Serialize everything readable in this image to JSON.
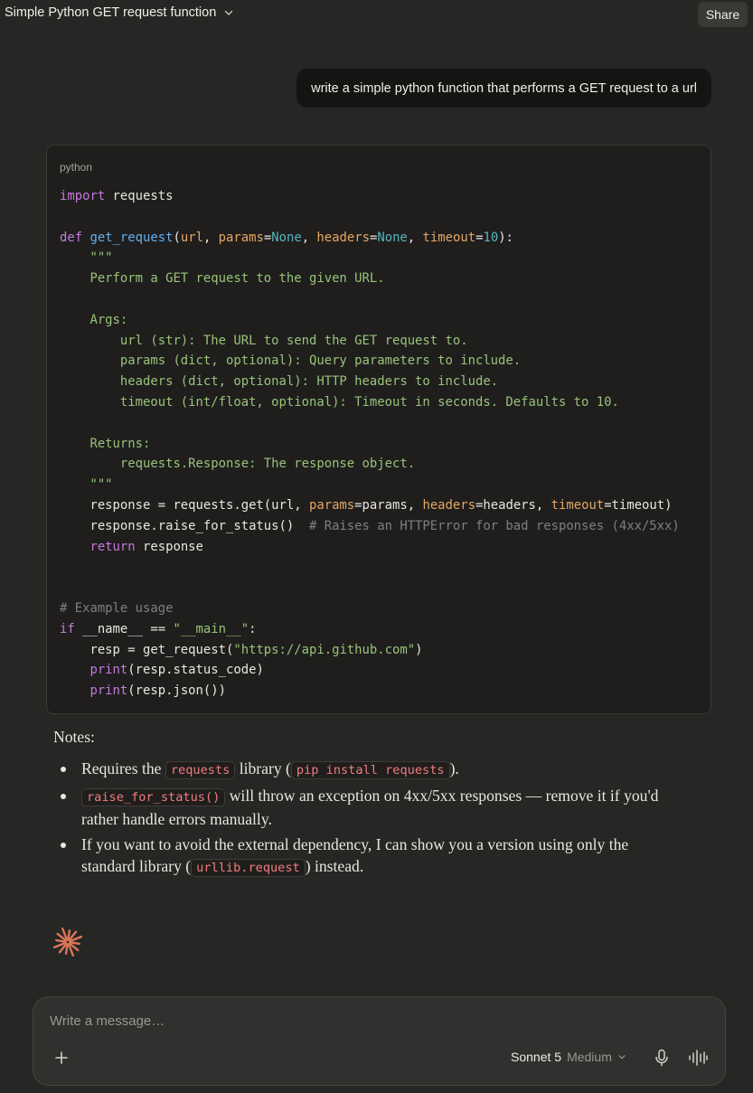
{
  "header": {
    "chat_title": "Simple Python GET request function",
    "share_label": "Share",
    "dropdown_icon": "chevron-down-icon"
  },
  "user_message": "write a simple python function that performs a GET request to a url",
  "code_block": {
    "language": "python",
    "lines": [
      "import requests",
      "",
      "def get_request(url, params=None, headers=None, timeout=10):",
      "    \"\"\"",
      "    Perform a GET request to the given URL.",
      "",
      "    Args:",
      "        url (str): The URL to send the GET request to.",
      "        params (dict, optional): Query parameters to include.",
      "        headers (dict, optional): HTTP headers to include.",
      "        timeout (int/float, optional): Timeout in seconds. Defaults to 10.",
      "",
      "    Returns:",
      "        requests.Response: The response object.",
      "    \"\"\"",
      "    response = requests.get(url, params=params, headers=headers, timeout=timeout)",
      "    response.raise_for_status()  # Raises an HTTPError for bad responses (4xx/5xx)",
      "    return response",
      "",
      "",
      "# Example usage",
      "if __name__ == \"__main__\":",
      "    resp = get_request(\"https://api.github.com\")",
      "    print(resp.status_code)",
      "    print(resp.json())"
    ]
  },
  "notes": {
    "heading": "Notes:",
    "item1": {
      "pre": "Requires the ",
      "code1": "requests",
      "mid": " library (",
      "code2": "pip install requests",
      "post": ")."
    },
    "item2": {
      "code": "raise_for_status()",
      "post": " will throw an exception on 4xx/5xx responses — remove it if you'd rather handle errors manually."
    },
    "item3": {
      "pre": "If you want to avoid the external dependency, I can show you a version using only the standard library (",
      "code": "urllib.request",
      "post": ") instead."
    }
  },
  "composer": {
    "placeholder": "Write a message…",
    "model_name": "Sonnet 5",
    "effort": "Medium"
  },
  "colors": {
    "background": "#262624",
    "accent_spark": "#d97757",
    "inline_code": "#ef7d7d"
  }
}
